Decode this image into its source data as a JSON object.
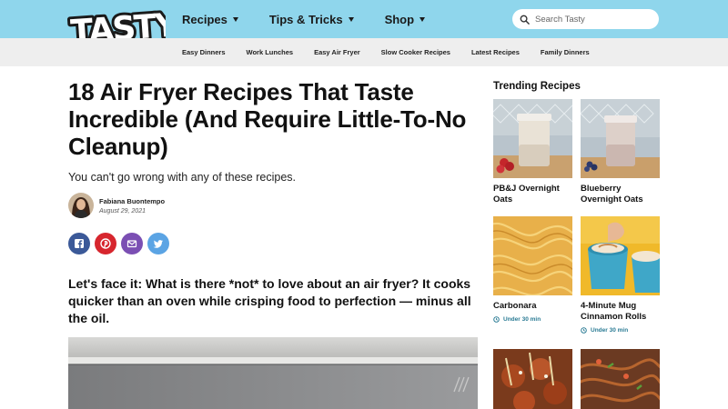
{
  "header": {
    "logo_text": "TASTY",
    "nav": [
      {
        "label": "Recipes"
      },
      {
        "label": "Tips & Tricks"
      },
      {
        "label": "Shop"
      }
    ],
    "search_placeholder": "Search Tasty",
    "subnav": [
      "Easy Dinners",
      "Work Lunches",
      "Easy Air Fryer",
      "Slow Cooker Recipes",
      "Latest Recipes",
      "Family Dinners"
    ]
  },
  "article": {
    "headline": "18 Air Fryer Recipes That Taste Incredible (And Require Little-To-No Cleanup)",
    "dek": "You can't go wrong with any of these recipes.",
    "author": "Fabiana Buontempo",
    "date": "August 29, 2021",
    "share": [
      {
        "icon": "facebook-icon",
        "color": "#3b5998"
      },
      {
        "icon": "pinterest-icon",
        "color": "#d7262e"
      },
      {
        "icon": "email-icon",
        "color": "#7b4fb3"
      },
      {
        "icon": "twitter-icon",
        "color": "#5ba4e4"
      }
    ],
    "lede": "Let's face it: What is there *not* to love about an air fryer? It cooks quicker than an oven while crisping food to perfection — minus all the oil."
  },
  "sidebar": {
    "title": "Trending Recipes",
    "cards": [
      {
        "title": "PB&J Overnight Oats",
        "time": ""
      },
      {
        "title": "Blueberry Overnight Oats",
        "time": ""
      },
      {
        "title": "Carbonara",
        "time": "Under 30 min"
      },
      {
        "title": "4-Minute Mug Cinnamon Rolls",
        "time": "Under 30 min"
      },
      {
        "title": "",
        "time": ""
      },
      {
        "title": "",
        "time": ""
      }
    ]
  },
  "colors": {
    "header_bg": "#8fd6ec",
    "subnav_bg": "#eeeeee",
    "time_accent": "#2a7b94"
  }
}
